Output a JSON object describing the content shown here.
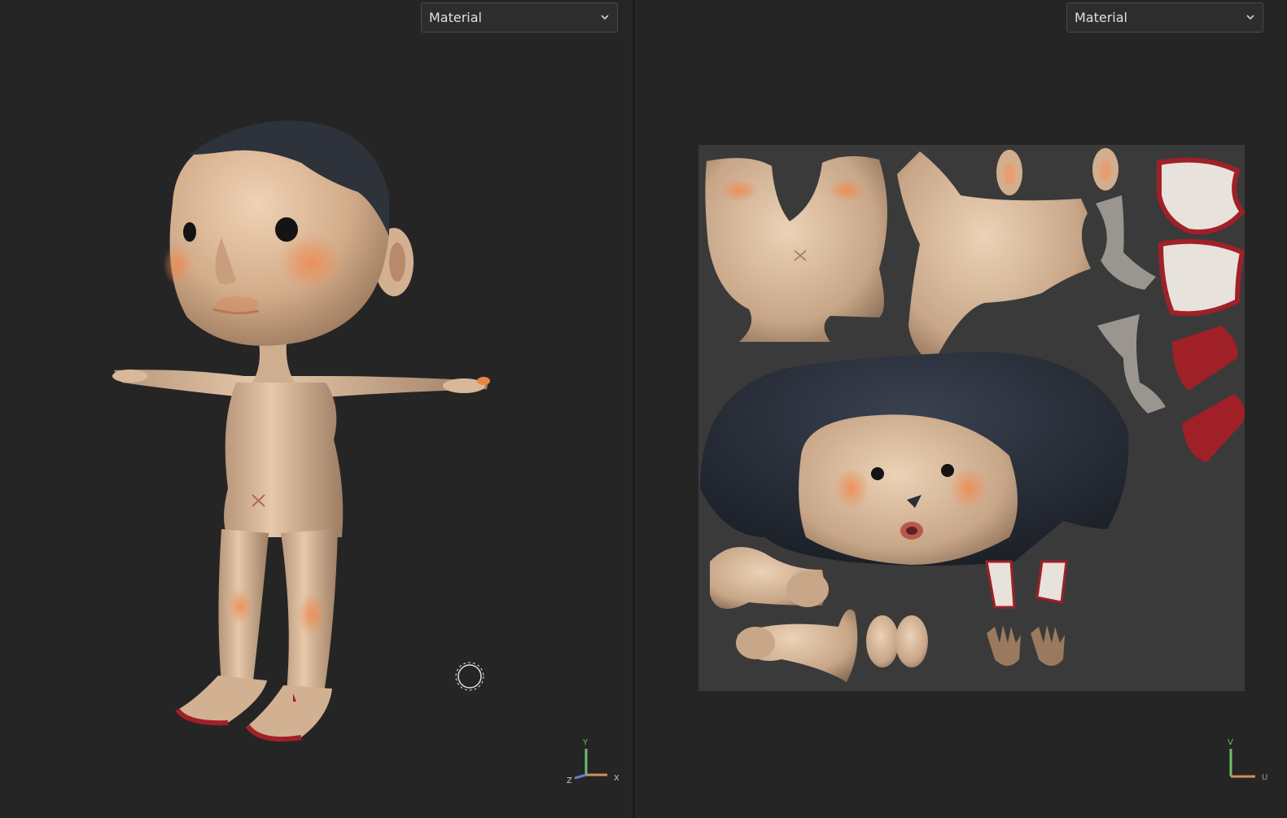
{
  "left_viewport": {
    "shading_mode": "Material",
    "axes": {
      "y": "Y",
      "x": "X",
      "z": "Z"
    }
  },
  "right_viewport": {
    "shading_mode": "Material",
    "axes": {
      "v": "V",
      "u": "U"
    }
  },
  "colors": {
    "background": "#252525",
    "uv_canvas": "#3a3a3a",
    "skin": "#d6b08e",
    "hair": "#2a2f38",
    "blush": "#e8905a",
    "accent_red": "#a02028"
  }
}
